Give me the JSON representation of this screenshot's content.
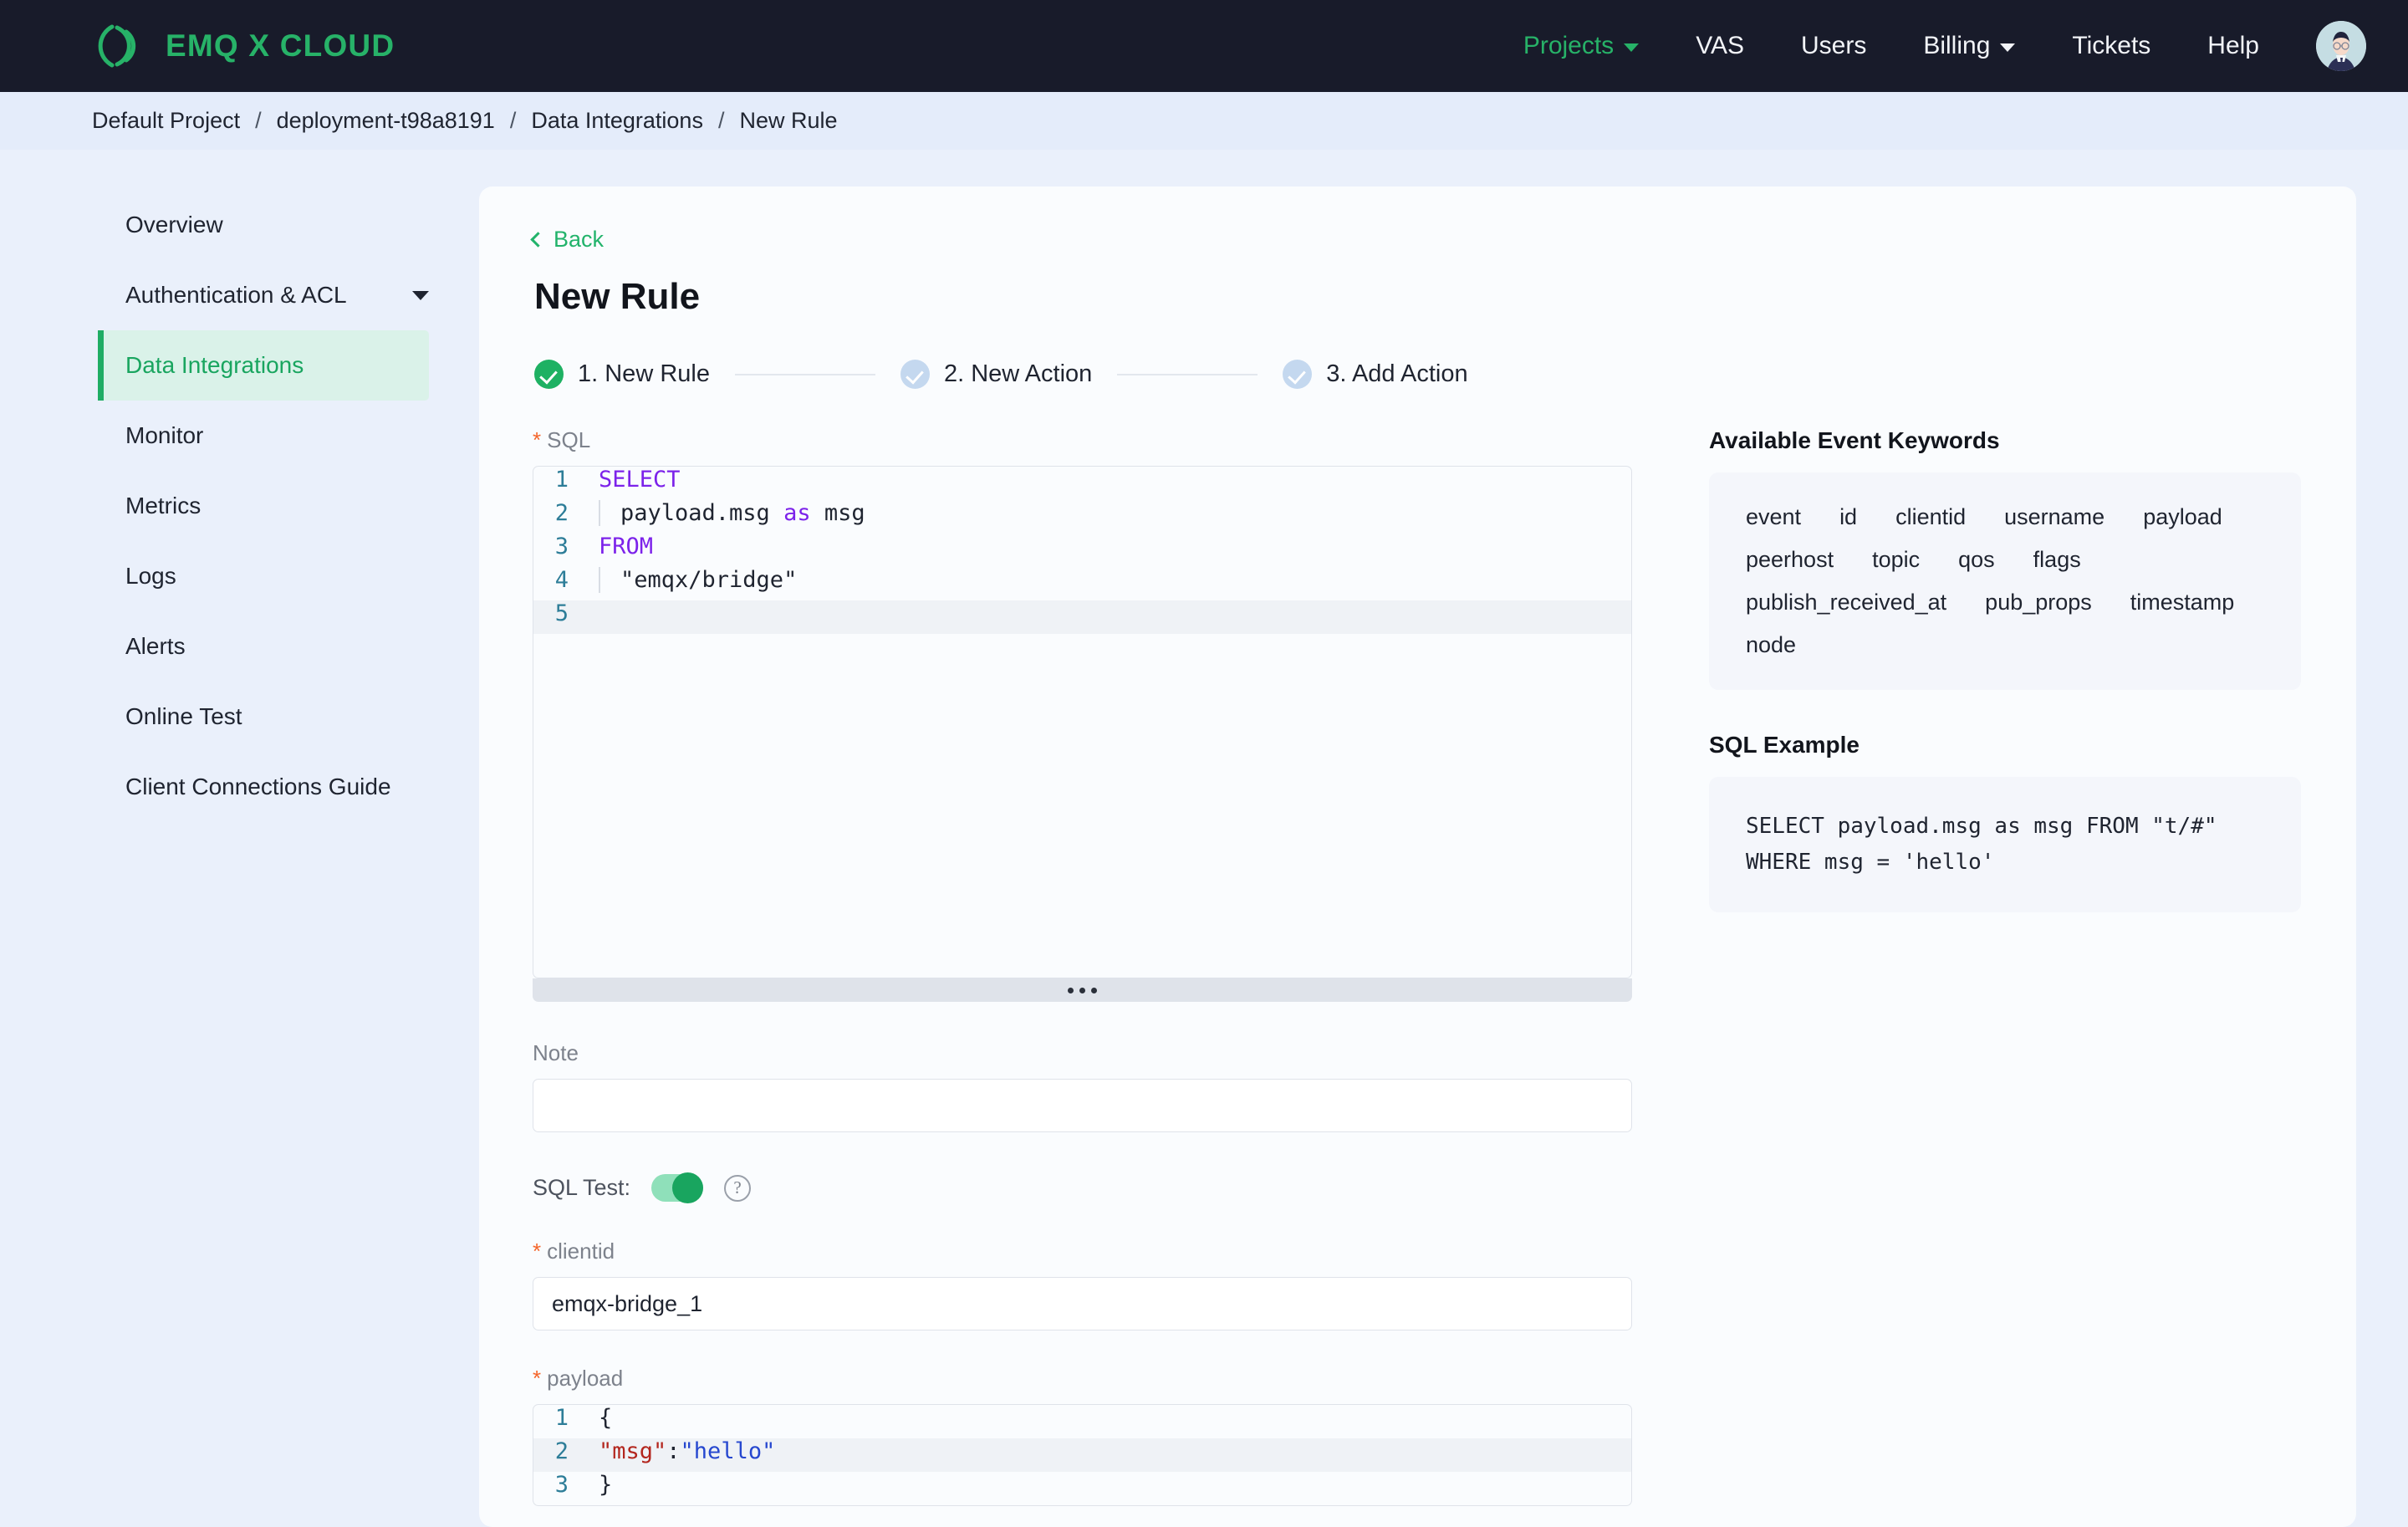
{
  "header": {
    "brand": "EMQ X CLOUD",
    "logo_icon": "emqx-logo-icon",
    "nav": [
      {
        "label": "Projects",
        "accent": true,
        "caret": true
      },
      {
        "label": "VAS",
        "accent": false,
        "caret": false
      },
      {
        "label": "Users",
        "accent": false,
        "caret": false
      },
      {
        "label": "Billing",
        "accent": false,
        "caret": true
      },
      {
        "label": "Tickets",
        "accent": false,
        "caret": false
      },
      {
        "label": "Help",
        "accent": false,
        "caret": false
      }
    ],
    "avatar_icon": "user-avatar-icon"
  },
  "breadcrumb": {
    "items": [
      "Default Project",
      "deployment-t98a8191",
      "Data Integrations",
      "New Rule"
    ],
    "separator": "/"
  },
  "sidebar": {
    "items": [
      {
        "label": "Overview",
        "active": false,
        "expandable": false
      },
      {
        "label": "Authentication & ACL",
        "active": false,
        "expandable": true
      },
      {
        "label": "Data Integrations",
        "active": true,
        "expandable": false
      },
      {
        "label": "Monitor",
        "active": false,
        "expandable": false
      },
      {
        "label": "Metrics",
        "active": false,
        "expandable": false
      },
      {
        "label": "Logs",
        "active": false,
        "expandable": false
      },
      {
        "label": "Alerts",
        "active": false,
        "expandable": false
      },
      {
        "label": "Online Test",
        "active": false,
        "expandable": false
      },
      {
        "label": "Client Connections Guide",
        "active": false,
        "expandable": false
      }
    ]
  },
  "main": {
    "back_label": "Back",
    "title": "New Rule",
    "steps": [
      {
        "label": "1. New Rule",
        "state": "done"
      },
      {
        "label": "2. New Action",
        "state": "pending"
      },
      {
        "label": "3. Add Action",
        "state": "pending"
      }
    ],
    "sql_field": {
      "label": "SQL",
      "required": true,
      "lines": [
        {
          "n": "1",
          "segments": [
            {
              "t": "SELECT",
              "c": "kw"
            }
          ],
          "indent": false,
          "highlight": false
        },
        {
          "n": "2",
          "segments": [
            {
              "t": "payload.msg ",
              "c": ""
            },
            {
              "t": "as",
              "c": "kw"
            },
            {
              "t": " msg",
              "c": ""
            }
          ],
          "indent": true,
          "highlight": false
        },
        {
          "n": "3",
          "segments": [
            {
              "t": "FROM",
              "c": "kw"
            }
          ],
          "indent": false,
          "highlight": false
        },
        {
          "n": "4",
          "segments": [
            {
              "t": "\"emqx/bridge\"",
              "c": ""
            }
          ],
          "indent": true,
          "highlight": false
        },
        {
          "n": "5",
          "segments": [
            {
              "t": "",
              "c": ""
            }
          ],
          "indent": true,
          "highlight": true
        }
      ]
    },
    "note_field": {
      "label": "Note",
      "value": "",
      "placeholder": ""
    },
    "sql_test": {
      "label": "SQL Test:",
      "enabled": true,
      "help_icon": "question-mark-icon"
    },
    "clientid_field": {
      "label": "clientid",
      "required": true,
      "value": "emqx-bridge_1",
      "placeholder": ""
    },
    "payload_field": {
      "label": "payload",
      "required": true,
      "lines": [
        {
          "n": "1",
          "segments": [
            {
              "t": "{",
              "c": ""
            }
          ],
          "highlight": false
        },
        {
          "n": "2",
          "segments": [
            {
              "t": "\"msg\"",
              "c": "jkey"
            },
            {
              "t": ":",
              "c": ""
            },
            {
              "t": "\"hello\"",
              "c": "jval"
            }
          ],
          "highlight": true
        },
        {
          "n": "3",
          "segments": [
            {
              "t": "}",
              "c": ""
            }
          ],
          "highlight": false
        }
      ]
    }
  },
  "aside": {
    "keywords_title": "Available Event Keywords",
    "keywords": [
      "event",
      "id",
      "clientid",
      "username",
      "payload",
      "peerhost",
      "topic",
      "qos",
      "flags",
      "publish_received_at",
      "pub_props",
      "timestamp",
      "node"
    ],
    "example_title": "SQL Example",
    "example_code": "SELECT payload.msg as msg FROM \"t/#\"\nWHERE msg = 'hello'"
  },
  "colors": {
    "brand_green": "#27b268",
    "accent_green": "#1fad64",
    "header_bg": "#181b2a",
    "page_bg": "#eaf0fb",
    "required_star": "#f4652a",
    "keyword_purple": "#7c22ea",
    "linenum_blue": "#2d7d98"
  }
}
